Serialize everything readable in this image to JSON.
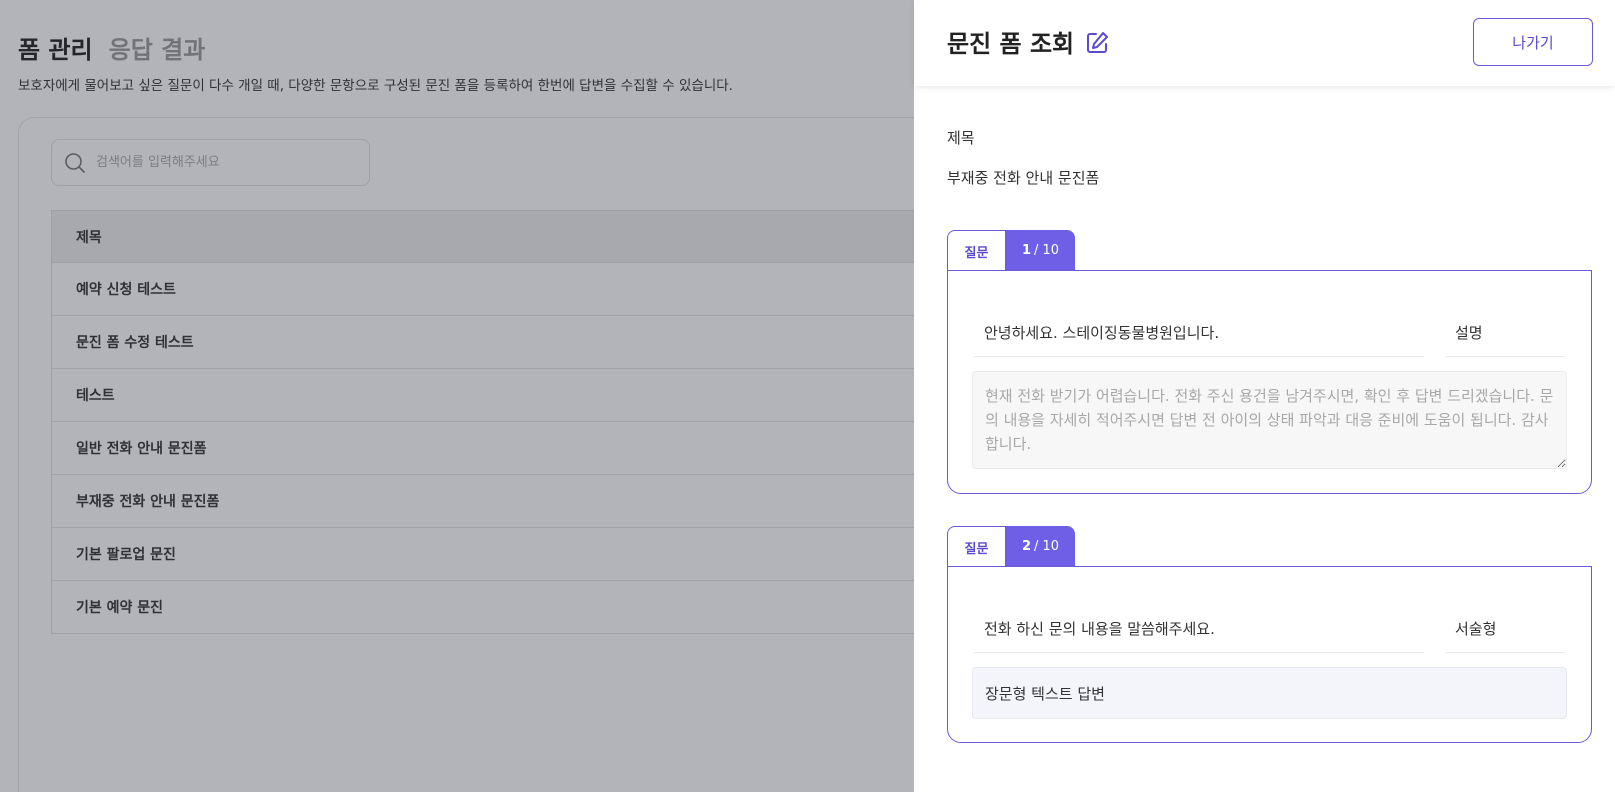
{
  "page": {
    "tabs": [
      {
        "label": "폼 관리",
        "active": true
      },
      {
        "label": "응답 결과",
        "active": false
      }
    ],
    "description": "보호자에게 물어보고 싶은 질문이 다수 개일 때, 다양한 문항으로 구성된 문진 폼을 등록하여 한번에 답변을 수집할 수 있습니다."
  },
  "search": {
    "placeholder": "검색어를 입력해주세요",
    "icon": "search-icon"
  },
  "table": {
    "header": "제목",
    "rows": [
      "예약 신청 테스트",
      "문진 폼 수정 테스트",
      "테스트",
      "일반 전화 안내 문진폼",
      "부재중 전화 안내 문진폼",
      "기본 팔로업 문진",
      "기본 예약 문진"
    ]
  },
  "drawer": {
    "title": "문진 폼 조회",
    "edit_icon": "edit-icon",
    "exit_label": "나가기",
    "field_label": "제목",
    "field_value": "부재중 전화 안내 문진폼",
    "questions": [
      {
        "tab_label": "질문",
        "index": "1",
        "total": "/ 10",
        "text": "안녕하세요. 스테이징동물병원입니다.",
        "type": "설명",
        "description": "현재 전화 받기가 어렵습니다. 전화 주신 용건을 남겨주시면, 확인 후 답변 드리겠습니다. 문의 내용을 자세히 적어주시면 답변 전 아이의 상태 파악과 대응 준비에 도움이 됩니다. 감사합니다."
      },
      {
        "tab_label": "질문",
        "index": "2",
        "total": "/ 10",
        "text": "전화 하신 문의 내용을 말씀해주세요.",
        "type": "서술형",
        "answer": "장문형 텍스트 답변"
      }
    ]
  },
  "colors": {
    "accent": "#6f5fe6",
    "accent_border": "#6a5ad8",
    "overlay": "#2d303c"
  }
}
